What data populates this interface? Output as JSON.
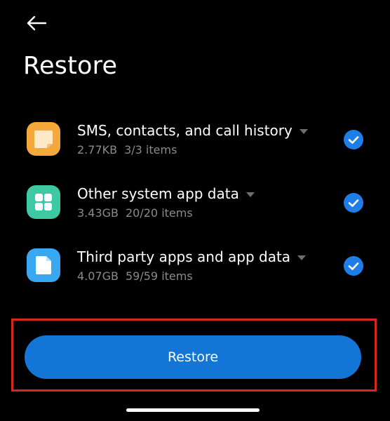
{
  "header": {
    "back_icon": "arrow-left-icon",
    "title": "Restore"
  },
  "items": [
    {
      "title": "SMS, contacts, and call history",
      "size": "2.77KB",
      "count": "3/3 items",
      "icon": "message-icon",
      "icon_color": "#F6A93B",
      "checked": true
    },
    {
      "title": "Other system app data",
      "size": "3.43GB",
      "count": "20/20 items",
      "icon": "grid-icon",
      "icon_color": "#3CC9A4",
      "checked": true
    },
    {
      "title": "Third party apps and app data",
      "size": "4.07GB",
      "count": "59/59 items",
      "icon": "document-icon",
      "icon_color": "#3AA8F0",
      "checked": true
    }
  ],
  "restore_button": {
    "label": "Restore"
  },
  "colors": {
    "background": "#000000",
    "accent": "#1376D6",
    "check": "#1F7DE8",
    "highlight": "#D6271C",
    "secondary_text": "#8A8A8A"
  }
}
